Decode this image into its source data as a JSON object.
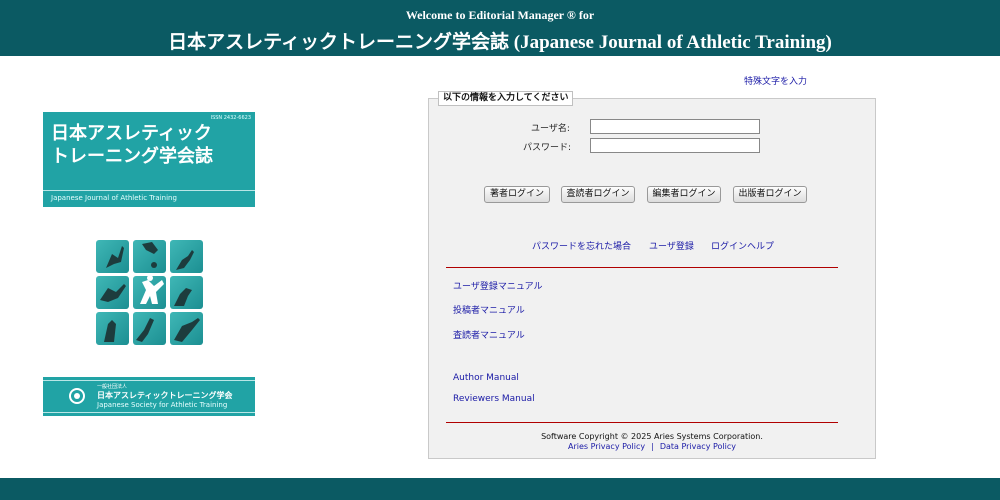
{
  "header": {
    "welcome": "Welcome to Editorial Manager ® for",
    "journal_title": "日本アスレティックトレーニング学会誌 (Japanese Journal of Athletic Training)"
  },
  "cover": {
    "issn": "ISSN 2432-6623",
    "title_jp": "日本アスレティック\nトレーニング学会誌",
    "title_en": "Japanese Journal of Athletic Training",
    "society_small": "一般社団法人",
    "society_jp": "日本アスレティックトレーニング学会",
    "society_en": "Japanese Society for Athletic Training"
  },
  "special_chars_link": "特殊文字を入力",
  "login": {
    "legend": "以下の情報を入力してください",
    "username_label": "ユーザ名:",
    "username_value": "",
    "password_label": "パスワード:",
    "password_value": "",
    "buttons": {
      "author": "著者ログイン",
      "reviewer": "査読者ログイン",
      "editor": "編集者ログイン",
      "publisher": "出版者ログイン"
    },
    "links": {
      "forgot_password": "パスワードを忘れた場合",
      "register": "ユーザ登録",
      "login_help": "ログインヘルプ"
    }
  },
  "manuals": {
    "user_registration": "ユーザ登録マニュアル",
    "contributor": "投稿者マニュアル",
    "reviewer": "査読者マニュアル",
    "author_en": "Author Manual",
    "reviewers_en": "Reviewers Manual"
  },
  "footer": {
    "copyright": "Software Copyright © 2025 Aries Systems Corporation.",
    "aries_privacy": "Aries Privacy Policy",
    "separator": "|",
    "data_privacy": "Data Privacy Policy"
  },
  "colors": {
    "banner": "#0b5a63",
    "cover_teal": "#21a3a5",
    "link": "#1a1aa6",
    "rule": "#b00000"
  }
}
